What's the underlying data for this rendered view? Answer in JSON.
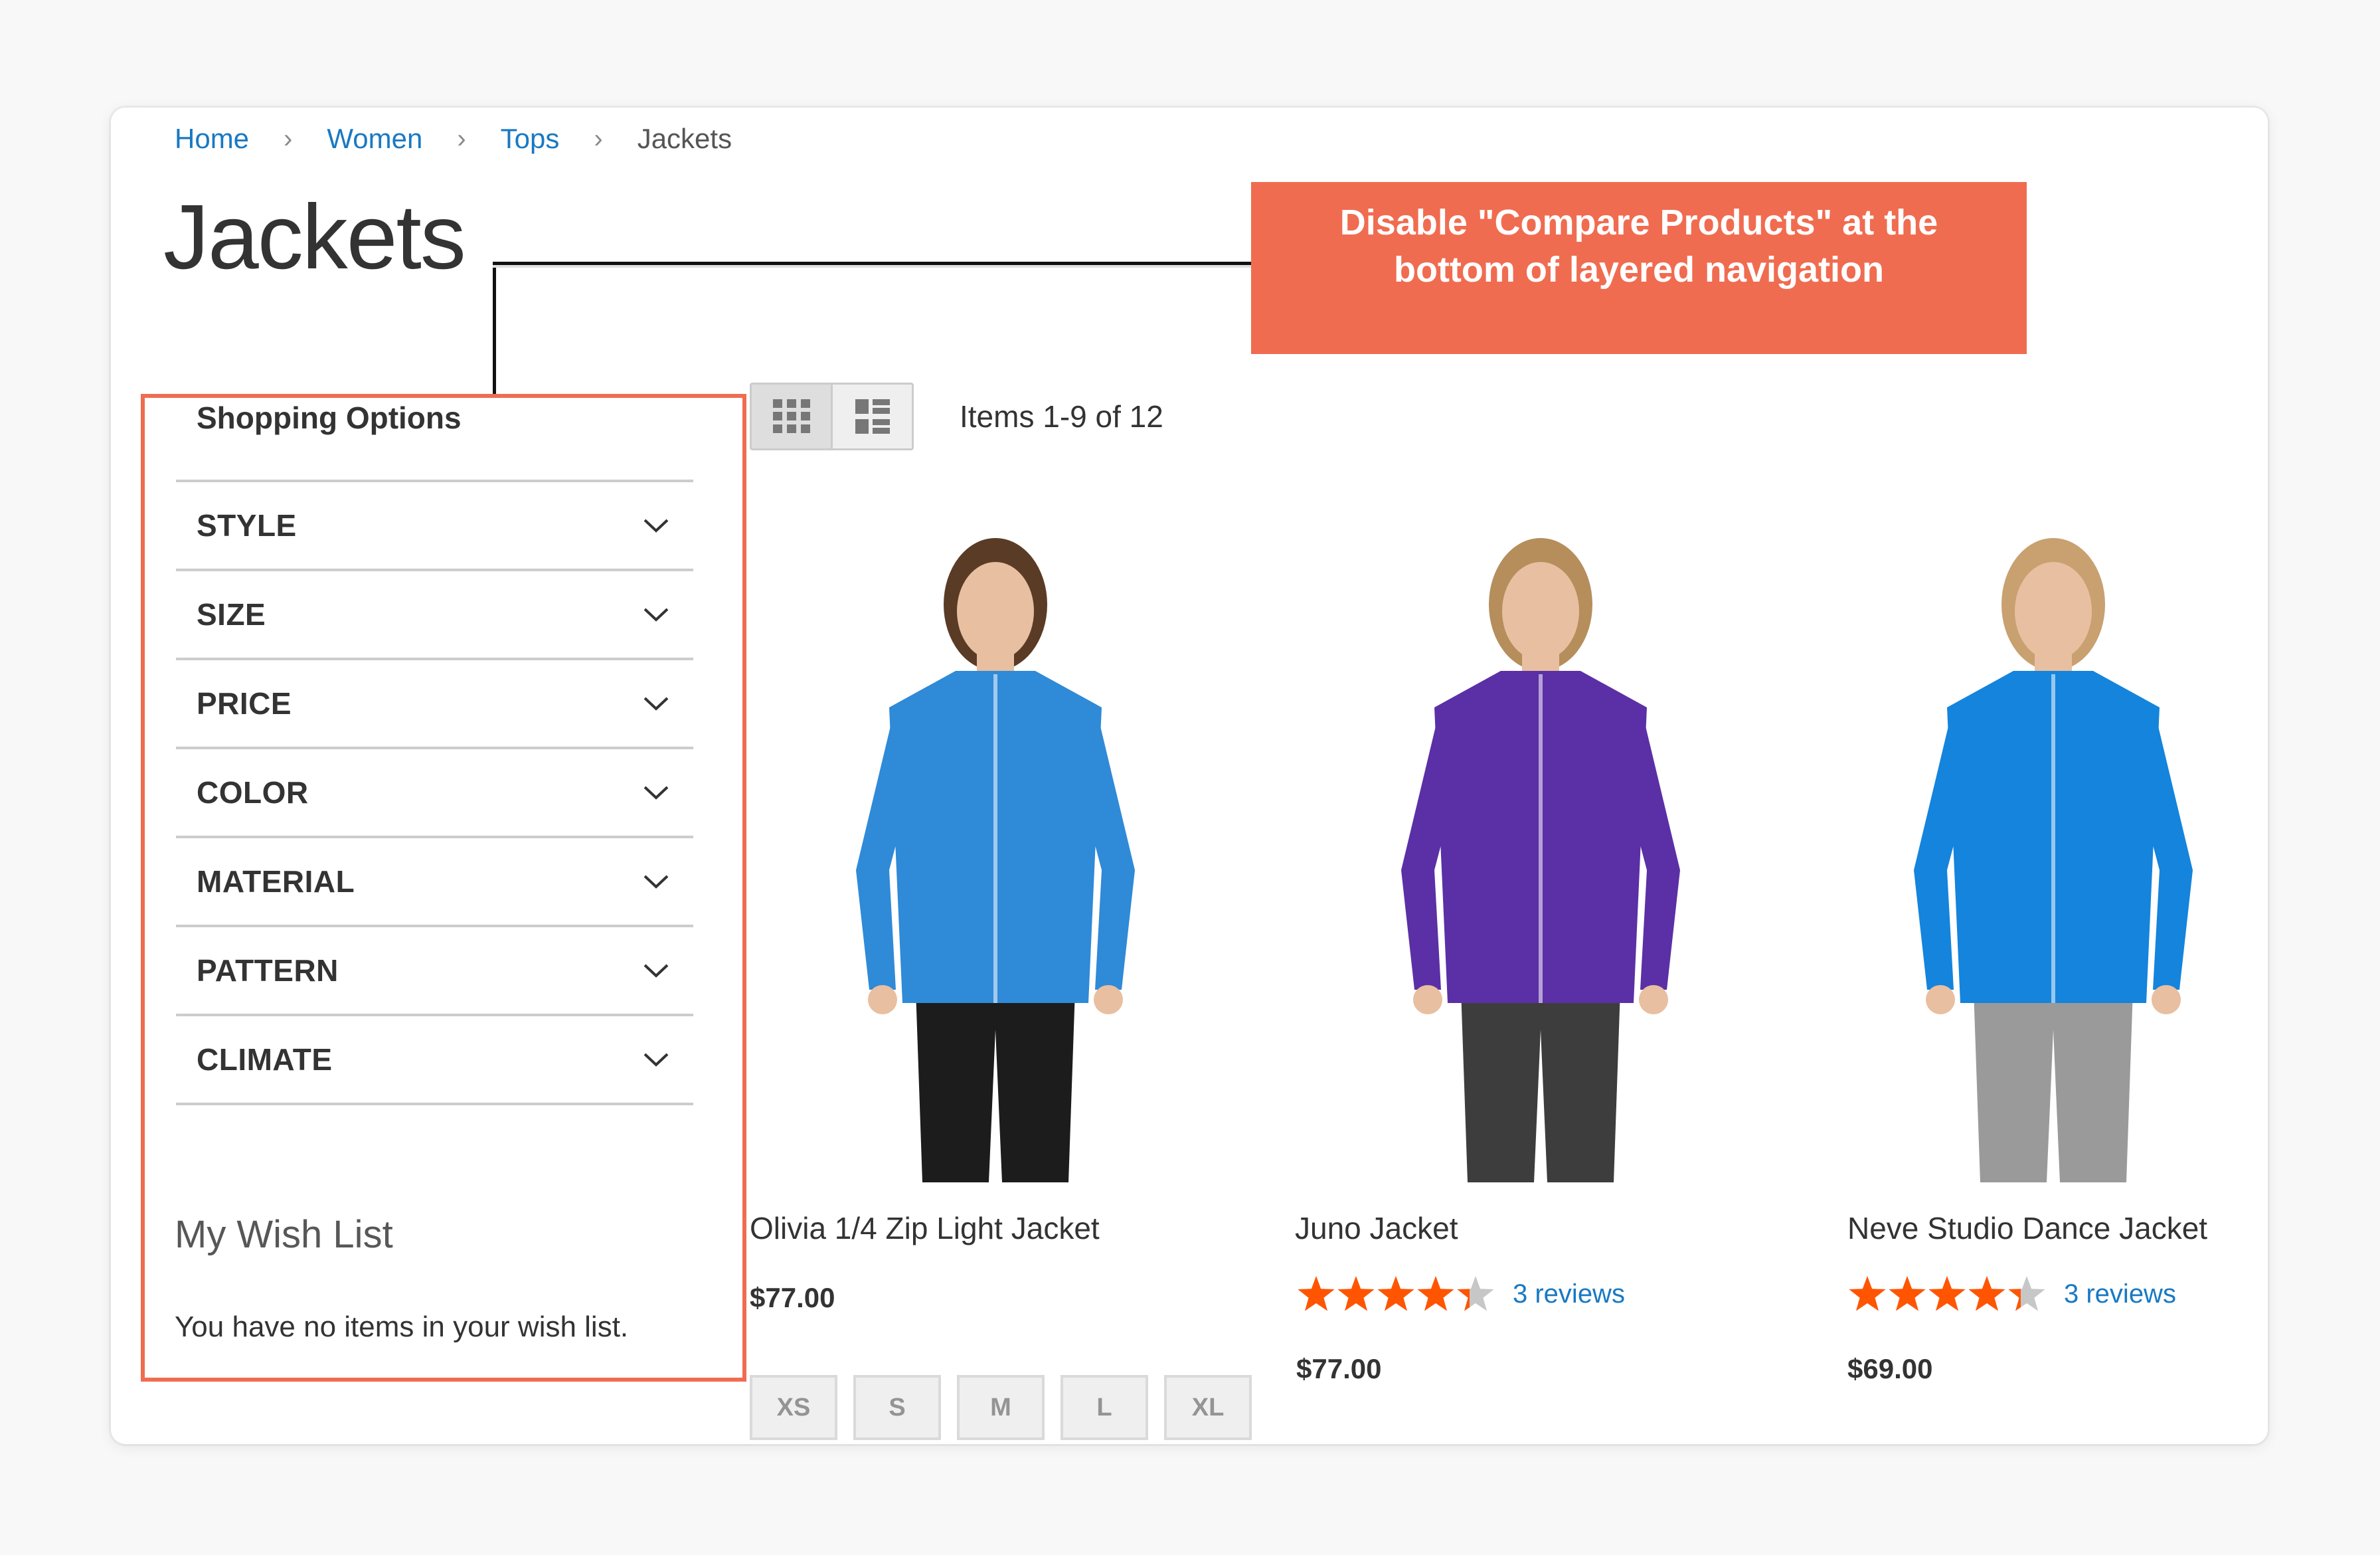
{
  "breadcrumb": {
    "items": [
      {
        "label": "Home",
        "link": true
      },
      {
        "label": "Women",
        "link": true
      },
      {
        "label": "Tops",
        "link": true
      },
      {
        "label": "Jackets",
        "link": false
      }
    ],
    "separator": "›"
  },
  "page_title": "Jackets",
  "annotation": {
    "line1": "Disable \"Compare Products\" at the",
    "line2": "bottom of layered navigation",
    "color": "#f06c50"
  },
  "sidebar": {
    "title": "Shopping Options",
    "filters": [
      {
        "label": "STYLE",
        "icon": "chevron-down-icon"
      },
      {
        "label": "SIZE",
        "icon": "chevron-down-icon"
      },
      {
        "label": "PRICE",
        "icon": "chevron-down-icon"
      },
      {
        "label": "COLOR",
        "icon": "chevron-down-icon"
      },
      {
        "label": "MATERIAL",
        "icon": "chevron-down-icon"
      },
      {
        "label": "PATTERN",
        "icon": "chevron-down-icon"
      },
      {
        "label": "CLIMATE",
        "icon": "chevron-down-icon"
      }
    ],
    "wishlist": {
      "title": "My Wish List",
      "empty_message": "You have no items in your wish list."
    }
  },
  "toolbar": {
    "modes": [
      {
        "name": "grid",
        "icon": "grid-view-icon",
        "active": true
      },
      {
        "name": "list",
        "icon": "list-view-icon",
        "active": false
      }
    ],
    "items_count": "Items 1-9 of 12"
  },
  "products": [
    {
      "name": "Olivia 1/4 Zip Light Jacket",
      "price": "$77.00",
      "rating_percent": null,
      "reviews": null,
      "sizes": [
        "XS",
        "S",
        "M",
        "L",
        "XL"
      ],
      "jacket_color": "#2f8ad8",
      "pants_color": "#1c1c1c",
      "hair_color": "#5a3b26"
    },
    {
      "name": "Juno Jacket",
      "price": "$77.00",
      "rating_percent": 87,
      "reviews": "3 reviews",
      "jacket_color": "#5b2fa6",
      "pants_color": "#3d3d3d",
      "hair_color": "#b58e5c"
    },
    {
      "name": "Neve Studio Dance Jacket",
      "price": "$69.00",
      "rating_percent": 87,
      "reviews": "3 reviews",
      "jacket_color": "#1484dc",
      "pants_color": "#9a9a9a",
      "hair_color": "#c9a070"
    }
  ],
  "colors": {
    "link": "#1979c3",
    "star_filled": "#ff5501",
    "star_empty": "#c7c7c7",
    "highlight_border": "#f06c50"
  }
}
